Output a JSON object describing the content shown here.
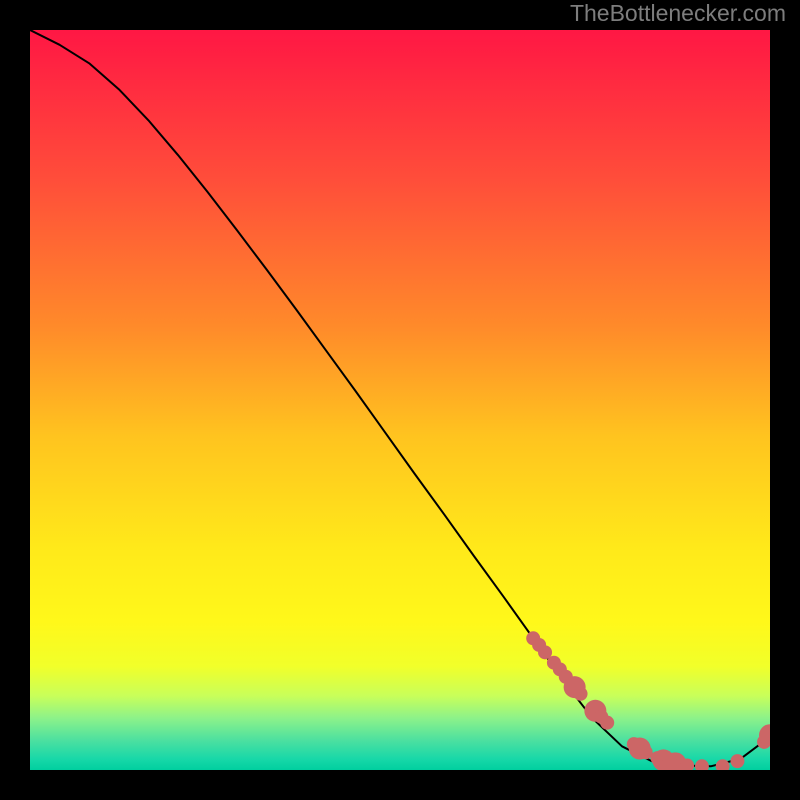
{
  "watermark": "TheBottlenecker.com",
  "chart_data": {
    "type": "line",
    "title": "",
    "xlabel": "",
    "ylabel": "",
    "xlim": [
      0,
      100
    ],
    "ylim": [
      0,
      100
    ],
    "grid": false,
    "legend": false,
    "curve": {
      "x": [
        0,
        4,
        8,
        12,
        16,
        20,
        24,
        28,
        32,
        36,
        40,
        44,
        48,
        52,
        56,
        60,
        64,
        68,
        72,
        76,
        80,
        84,
        88,
        92,
        96,
        100
      ],
      "y": [
        100,
        98,
        95.5,
        92,
        87.8,
        83.1,
        78.1,
        72.9,
        67.6,
        62.2,
        56.7,
        51.2,
        45.6,
        40.0,
        34.5,
        28.9,
        23.4,
        17.8,
        12.2,
        7.0,
        3.2,
        1.2,
        0.6,
        0.5,
        1.5,
        4.5
      ]
    },
    "markers": {
      "color": "#cc6666",
      "x": [
        68.0,
        68.8,
        69.6,
        70.8,
        71.6,
        72.4,
        73.6,
        74.4,
        76.4,
        77.2,
        78.0,
        81.6,
        82.4,
        83.2,
        84.8,
        85.6,
        86.4,
        87.2,
        88.0,
        88.8,
        90.8,
        93.6,
        95.6,
        99.2,
        100.0
      ],
      "y": [
        17.8,
        16.9,
        15.9,
        14.5,
        13.6,
        12.6,
        11.2,
        10.3,
        8.0,
        7.2,
        6.4,
        3.5,
        2.9,
        2.4,
        1.6,
        1.3,
        1.1,
        0.9,
        0.7,
        0.6,
        0.5,
        0.5,
        1.2,
        3.8,
        4.7
      ],
      "sizes": [
        7,
        7,
        7,
        7,
        7,
        7,
        11,
        7,
        11,
        7,
        7,
        7,
        11,
        7,
        7,
        11,
        7,
        11,
        7,
        7,
        7,
        7,
        7,
        7,
        11
      ]
    },
    "background_gradient": {
      "stops": [
        {
          "offset": 0.0,
          "color": "#ff1744"
        },
        {
          "offset": 0.2,
          "color": "#ff4d3a"
        },
        {
          "offset": 0.4,
          "color": "#ff8a2a"
        },
        {
          "offset": 0.55,
          "color": "#ffc41f"
        },
        {
          "offset": 0.7,
          "color": "#ffe91a"
        },
        {
          "offset": 0.8,
          "color": "#fff81a"
        },
        {
          "offset": 0.86,
          "color": "#f1ff2a"
        },
        {
          "offset": 0.9,
          "color": "#c8ff5a"
        },
        {
          "offset": 0.93,
          "color": "#8cf28a"
        },
        {
          "offset": 0.96,
          "color": "#4ce0a0"
        },
        {
          "offset": 0.985,
          "color": "#18d8a8"
        },
        {
          "offset": 1.0,
          "color": "#00cf9f"
        }
      ]
    }
  }
}
